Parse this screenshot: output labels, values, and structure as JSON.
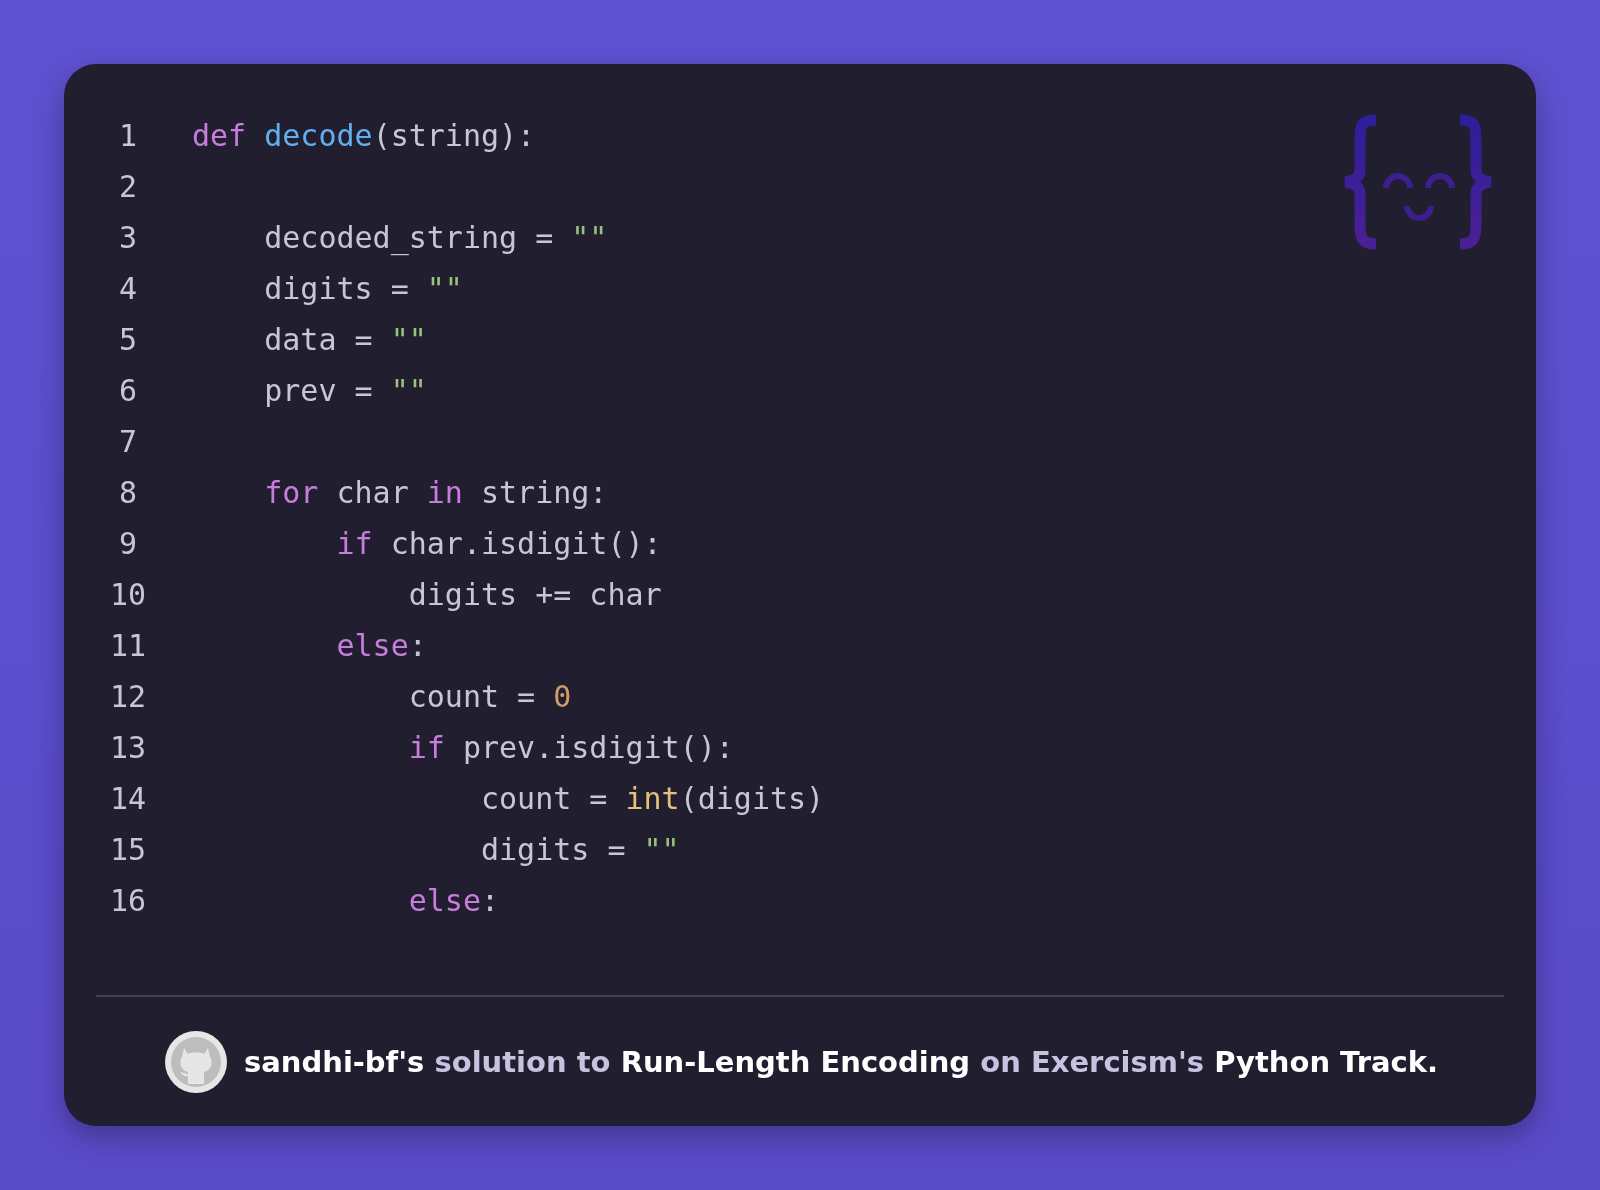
{
  "code": {
    "lines": [
      {
        "number": "1",
        "tokens": [
          {
            "kind": "keyword",
            "text": "def"
          },
          {
            "kind": "function",
            "text": " decode"
          },
          {
            "kind": "plain",
            "text": "(string):"
          }
        ]
      },
      {
        "number": "2"
      },
      {
        "number": "3",
        "tokens": [
          {
            "kind": "plain",
            "text": "    decoded_string = "
          },
          {
            "kind": "string",
            "text": "\"\""
          }
        ]
      },
      {
        "number": "4",
        "tokens": [
          {
            "kind": "plain",
            "text": "    digits = "
          },
          {
            "kind": "string",
            "text": "\"\""
          }
        ]
      },
      {
        "number": "5",
        "tokens": [
          {
            "kind": "plain",
            "text": "    data = "
          },
          {
            "kind": "string",
            "text": "\"\""
          }
        ]
      },
      {
        "number": "6",
        "tokens": [
          {
            "kind": "plain",
            "text": "    prev = "
          },
          {
            "kind": "string",
            "text": "\"\""
          }
        ]
      },
      {
        "number": "7"
      },
      {
        "number": "8",
        "tokens": [
          {
            "kind": "keyword",
            "text": "    for"
          },
          {
            "kind": "plain",
            "text": " char "
          },
          {
            "kind": "keyword",
            "text": "in"
          },
          {
            "kind": "plain",
            "text": " string:"
          }
        ]
      },
      {
        "number": "9",
        "tokens": [
          {
            "kind": "keyword",
            "text": "        if"
          },
          {
            "kind": "plain",
            "text": " char.isdigit():"
          }
        ]
      },
      {
        "number": "10",
        "tokens": [
          {
            "kind": "plain",
            "text": "            digits += char"
          }
        ]
      },
      {
        "number": "11",
        "tokens": [
          {
            "kind": "keyword",
            "text": "        else"
          },
          {
            "kind": "plain",
            "text": ":"
          }
        ]
      },
      {
        "number": "12",
        "tokens": [
          {
            "kind": "plain",
            "text": "            count = "
          },
          {
            "kind": "number",
            "text": "0"
          }
        ]
      },
      {
        "number": "13",
        "tokens": [
          {
            "kind": "keyword",
            "text": "            if"
          },
          {
            "kind": "plain",
            "text": " prev.isdigit():"
          }
        ]
      },
      {
        "number": "14",
        "tokens": [
          {
            "kind": "plain",
            "text": "                count = "
          },
          {
            "kind": "builtin",
            "text": "int"
          },
          {
            "kind": "plain",
            "text": "(digits)"
          }
        ]
      },
      {
        "number": "15",
        "tokens": [
          {
            "kind": "plain",
            "text": "                digits = "
          },
          {
            "kind": "string",
            "text": "\"\""
          }
        ]
      },
      {
        "number": "16",
        "tokens": [
          {
            "kind": "keyword",
            "text": "            else"
          },
          {
            "kind": "plain",
            "text": ":"
          }
        ]
      }
    ]
  },
  "footer": {
    "parts": [
      {
        "kind": "strong",
        "text": "sandhi-bf's"
      },
      {
        "kind": "muted",
        "text": "solution to"
      },
      {
        "kind": "strong",
        "text": "Run-Length Encoding"
      },
      {
        "kind": "muted",
        "text": "on Exercism's"
      },
      {
        "kind": "strong",
        "text": "Python Track."
      }
    ]
  }
}
